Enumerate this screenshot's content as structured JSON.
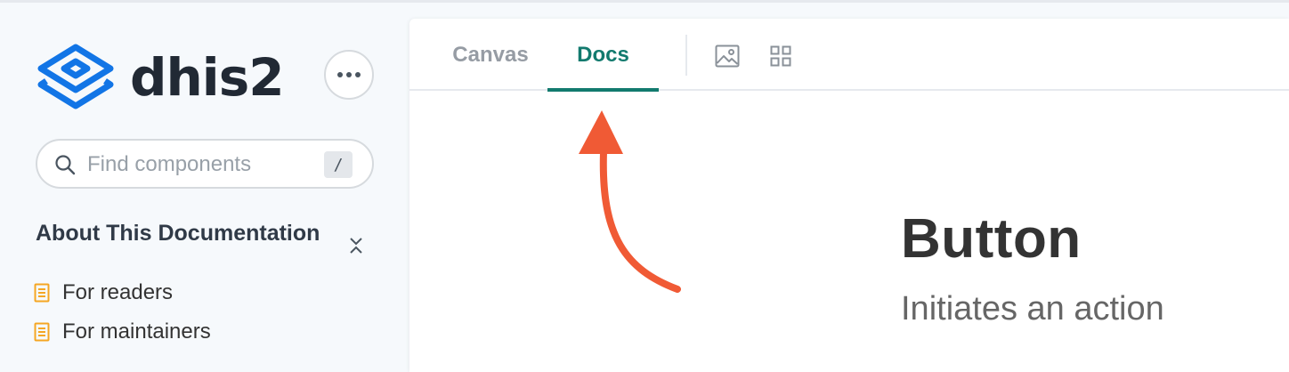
{
  "sidebar": {
    "brand": "dhis2",
    "search": {
      "placeholder": "Find components",
      "shortcut": "/"
    },
    "section": {
      "title": "About This Documentation",
      "items": [
        {
          "label": "For readers",
          "icon": "document-icon"
        },
        {
          "label": "For maintainers",
          "icon": "document-icon"
        }
      ]
    }
  },
  "toolbar": {
    "tabs": [
      {
        "label": "Canvas",
        "active": false
      },
      {
        "label": "Docs",
        "active": true
      }
    ],
    "tools": [
      "image-icon",
      "grid-icon"
    ]
  },
  "content": {
    "title": "Button",
    "subtitle": "Initiates an action"
  },
  "colors": {
    "accent": "#127a6e",
    "brand_blue": "#1275e6",
    "doc_icon": "#f5a623",
    "annotation_arrow": "#f05a35"
  }
}
